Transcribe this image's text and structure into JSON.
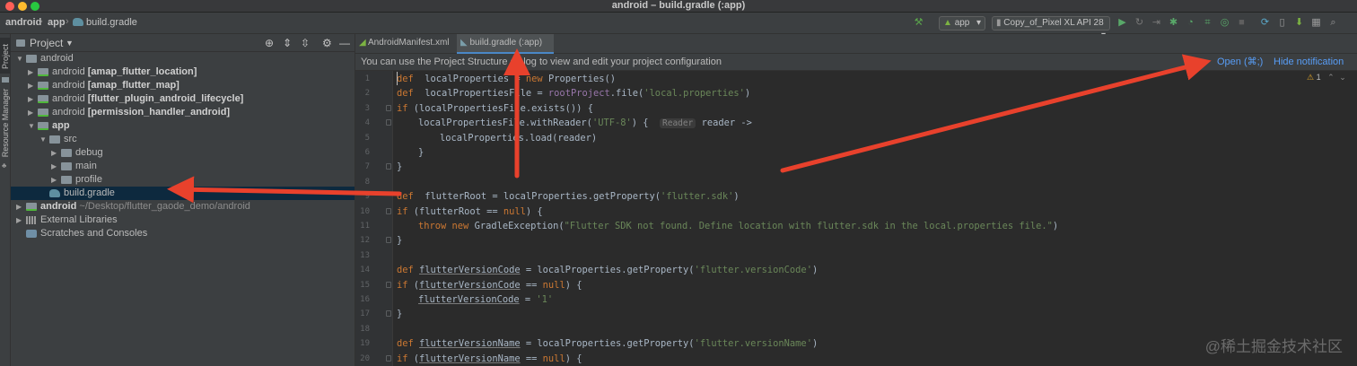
{
  "window": {
    "title": "android – build.gradle (:app)"
  },
  "breadcrumb": {
    "root": "android",
    "module": "app",
    "file": "build.gradle"
  },
  "toolbar": {
    "config": "app",
    "device": "Copy_of_Pixel XL API 28"
  },
  "side_stripe": {
    "project_label": "Project",
    "resource_label": "Resource Manager"
  },
  "project_panel": {
    "title": "Project"
  },
  "tree": [
    {
      "depth": 0,
      "arrow": "open",
      "icon": "folder",
      "pre": "android",
      "bold": "",
      "path": ""
    },
    {
      "depth": 1,
      "arrow": "closed",
      "icon": "module",
      "pre": "android ",
      "bold": "[amap_flutter_location]",
      "path": ""
    },
    {
      "depth": 1,
      "arrow": "closed",
      "icon": "module",
      "pre": "android ",
      "bold": "[amap_flutter_map]",
      "path": ""
    },
    {
      "depth": 1,
      "arrow": "closed",
      "icon": "module",
      "pre": "android ",
      "bold": "[flutter_plugin_android_lifecycle]",
      "path": ""
    },
    {
      "depth": 1,
      "arrow": "closed",
      "icon": "module",
      "pre": "android ",
      "bold": "[permission_handler_android]",
      "path": ""
    },
    {
      "depth": 1,
      "arrow": "open",
      "icon": "module",
      "pre": "",
      "bold": "app",
      "path": ""
    },
    {
      "depth": 2,
      "arrow": "open",
      "icon": "folder",
      "pre": "src",
      "bold": "",
      "path": ""
    },
    {
      "depth": 3,
      "arrow": "closed",
      "icon": "folder",
      "pre": "debug",
      "bold": "",
      "path": ""
    },
    {
      "depth": 3,
      "arrow": "closed",
      "icon": "folder",
      "pre": "main",
      "bold": "",
      "path": ""
    },
    {
      "depth": 3,
      "arrow": "closed",
      "icon": "folder",
      "pre": "profile",
      "bold": "",
      "path": ""
    },
    {
      "depth": 2,
      "arrow": "none",
      "icon": "gradle",
      "pre": "build.gradle",
      "bold": "",
      "path": "",
      "selected": true
    },
    {
      "depth": 0,
      "arrow": "closed",
      "icon": "module",
      "pre": "",
      "bold": "android",
      "path": "  ~/Desktop/flutter_gaode_demo/android"
    },
    {
      "depth": 0,
      "arrow": "closed",
      "icon": "library",
      "pre": "External Libraries",
      "bold": "",
      "path": ""
    },
    {
      "depth": 0,
      "arrow": "none",
      "icon": "scratch",
      "pre": "Scratches and Consoles",
      "bold": "",
      "path": ""
    }
  ],
  "tabs": [
    {
      "label": "AndroidManifest.xml",
      "active": false
    },
    {
      "label": "build.gradle (:app)",
      "active": true
    }
  ],
  "banner": {
    "message": "You can use the Project Structure dialog to view and edit your project configuration",
    "open_link": "Open (⌘;)",
    "hide_link": "Hide notification"
  },
  "inspection": {
    "warnings": "1"
  },
  "code_lines": [
    {
      "n": "1",
      "indent": 0,
      "tokens": [
        [
          "kw",
          "def"
        ],
        [
          "",
          "  localProperties = "
        ],
        [
          "kw",
          "new "
        ],
        [
          "cls",
          "Properties"
        ],
        [
          "",
          "()"
        ]
      ]
    },
    {
      "n": "2",
      "indent": 0,
      "tokens": [
        [
          "kw",
          "def"
        ],
        [
          "",
          "  localPropertiesFile = "
        ],
        [
          "fld",
          "rootProject"
        ],
        [
          "",
          ".file("
        ],
        [
          "str",
          "'local.properties'"
        ],
        [
          "",
          ")"
        ]
      ]
    },
    {
      "n": "3",
      "indent": 0,
      "tokens": [
        [
          "kw",
          "if"
        ],
        [
          "",
          " (localPropertiesFile.exists()) {"
        ]
      ]
    },
    {
      "n": "4",
      "indent": 1,
      "tokens": [
        [
          "",
          "localPropertiesFile.withReader("
        ],
        [
          "str",
          "'UTF-8'"
        ],
        [
          "",
          ") {  "
        ],
        [
          "hint",
          "Reader"
        ],
        [
          "",
          " reader ->"
        ]
      ]
    },
    {
      "n": "5",
      "indent": 2,
      "tokens": [
        [
          "",
          "localProperties.load(reader)"
        ]
      ]
    },
    {
      "n": "6",
      "indent": 1,
      "tokens": [
        [
          "",
          "}"
        ]
      ]
    },
    {
      "n": "7",
      "indent": 0,
      "tokens": [
        [
          "",
          "}"
        ]
      ]
    },
    {
      "n": "8",
      "indent": 0,
      "tokens": []
    },
    {
      "n": "9",
      "indent": 0,
      "tokens": [
        [
          "kw",
          "def"
        ],
        [
          "",
          "  flutterRoot = localProperties.getProperty("
        ],
        [
          "str",
          "'flutter.sdk'"
        ],
        [
          "",
          ")"
        ]
      ]
    },
    {
      "n": "10",
      "indent": 0,
      "tokens": [
        [
          "kw",
          "if"
        ],
        [
          "",
          " (flutterRoot == "
        ],
        [
          "kw",
          "null"
        ],
        [
          "",
          ") {"
        ]
      ]
    },
    {
      "n": "11",
      "indent": 1,
      "tokens": [
        [
          "kw",
          "throw new "
        ],
        [
          "",
          "GradleException("
        ],
        [
          "str",
          "\"Flutter SDK not found. Define location with flutter.sdk in the local.properties file.\""
        ],
        [
          "",
          ")"
        ]
      ]
    },
    {
      "n": "12",
      "indent": 0,
      "tokens": [
        [
          "",
          "}"
        ]
      ]
    },
    {
      "n": "13",
      "indent": 0,
      "tokens": []
    },
    {
      "n": "14",
      "indent": 0,
      "tokens": [
        [
          "kw",
          "def "
        ],
        [
          "ul",
          "flutterVersionCode"
        ],
        [
          "",
          " = localProperties.getProperty("
        ],
        [
          "str",
          "'flutter.versionCode'"
        ],
        [
          "",
          ")"
        ]
      ]
    },
    {
      "n": "15",
      "indent": 0,
      "tokens": [
        [
          "kw",
          "if"
        ],
        [
          "",
          " ("
        ],
        [
          "ul",
          "flutterVersionCode"
        ],
        [
          "",
          " == "
        ],
        [
          "kw",
          "null"
        ],
        [
          "",
          ") {"
        ]
      ]
    },
    {
      "n": "16",
      "indent": 1,
      "tokens": [
        [
          "ul",
          "flutterVersionCode"
        ],
        [
          "",
          " = "
        ],
        [
          "str",
          "'1'"
        ]
      ]
    },
    {
      "n": "17",
      "indent": 0,
      "tokens": [
        [
          "",
          "}"
        ]
      ]
    },
    {
      "n": "18",
      "indent": 0,
      "tokens": []
    },
    {
      "n": "19",
      "indent": 0,
      "tokens": [
        [
          "kw",
          "def "
        ],
        [
          "ul",
          "flutterVersionName"
        ],
        [
          "",
          " = localProperties.getProperty("
        ],
        [
          "str",
          "'flutter.versionName'"
        ],
        [
          "",
          ")"
        ]
      ]
    },
    {
      "n": "20",
      "indent": 0,
      "tokens": [
        [
          "kw",
          "if"
        ],
        [
          "",
          " ("
        ],
        [
          "ul",
          "flutterVersionName"
        ],
        [
          "",
          " == "
        ],
        [
          "kw",
          "null"
        ],
        [
          "",
          ") {"
        ]
      ]
    }
  ],
  "watermark": "@稀土掘金技术社区",
  "colors": {
    "accent": "#4a88c7",
    "annotation_arrow": "#e8412c",
    "keyword": "#cc7832",
    "string": "#6a8759"
  }
}
